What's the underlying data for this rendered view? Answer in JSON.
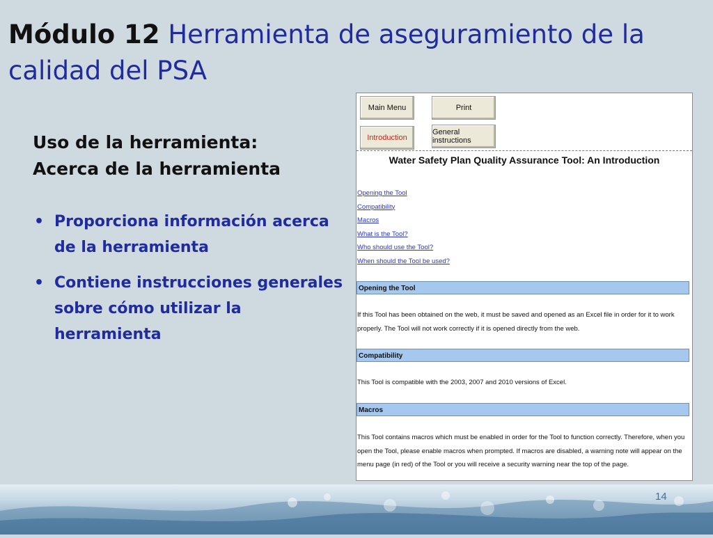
{
  "title": {
    "prefix": "Módulo 12",
    "rest": "Herramienta de aseguramiento de la calidad del PSA"
  },
  "subtitle": {
    "line1": "Uso de la herramienta:",
    "line2": "Acerca de la herramienta"
  },
  "bullets": [
    "Proporciona información acerca de la herramienta",
    "Contiene instrucciones generales sobre cómo utilizar la herramienta"
  ],
  "screenshot": {
    "buttons": {
      "main_menu": "Main Menu",
      "print": "Print",
      "introduction": "Introduction",
      "general_instructions": "General instructions"
    },
    "heading": "Water Safety Plan Quality Assurance Tool: An Introduction",
    "links": [
      "Opening the Tool",
      "Compatibility",
      "Macros",
      "What is the Tool?",
      "Who should use the Tool?",
      "When should the Tool be used?"
    ],
    "sections": [
      {
        "header": "Opening the Tool",
        "text": "If this Tool has been obtained on the web, it must be saved and opened as an Excel file in order for it to work properly.  The Tool will not work correctly if it is opened directly from the web."
      },
      {
        "header": "Compatibility",
        "text": "This Tool is compatible with the 2003, 2007 and 2010 versions of Excel."
      },
      {
        "header": "Macros",
        "text": "This Tool contains macros which must be enabled in order for the Tool to function correctly. Therefore, when you open the Tool, please enable macros when prompted.  If macros are disabled, a warning note will appear on the menu page (in red) of the Tool or you will receive a security warning near the top of the page."
      }
    ]
  },
  "slide_number": "14",
  "colors": {
    "background": "#ced9e0",
    "title_blue": "#1f2b9e",
    "section_bar": "#a6c8ee",
    "link_blue": "#2a36c8"
  }
}
